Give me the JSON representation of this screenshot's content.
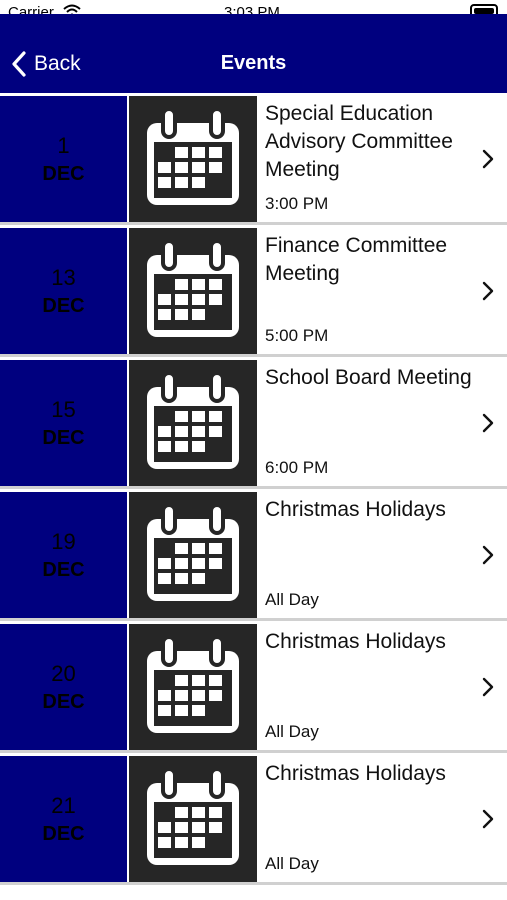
{
  "status": {
    "carrier": "Carrier",
    "time": "3:03 PM"
  },
  "nav": {
    "back_label": "Back",
    "title": "Events"
  },
  "events": [
    {
      "day": "1",
      "month": "DEC",
      "title": "Special Education Advisory Committee Meeting",
      "time": "3:00 PM"
    },
    {
      "day": "13",
      "month": "DEC",
      "title": "Finance Committee Meeting",
      "time": "5:00 PM"
    },
    {
      "day": "15",
      "month": "DEC",
      "title": "School Board Meeting",
      "time": "6:00 PM"
    },
    {
      "day": "19",
      "month": "DEC",
      "title": "Christmas Holidays",
      "time": "All Day"
    },
    {
      "day": "20",
      "month": "DEC",
      "title": "Christmas Holidays",
      "time": "All Day"
    },
    {
      "day": "21",
      "month": "DEC",
      "title": "Christmas Holidays",
      "time": "All Day"
    }
  ],
  "colors": {
    "nav_background": "#00007f",
    "date_background": "#00007f",
    "icon_background": "#262626"
  },
  "icons": {
    "back": "chevron-left-icon",
    "row": "calendar-icon",
    "disclosure": "chevron-right-icon"
  }
}
